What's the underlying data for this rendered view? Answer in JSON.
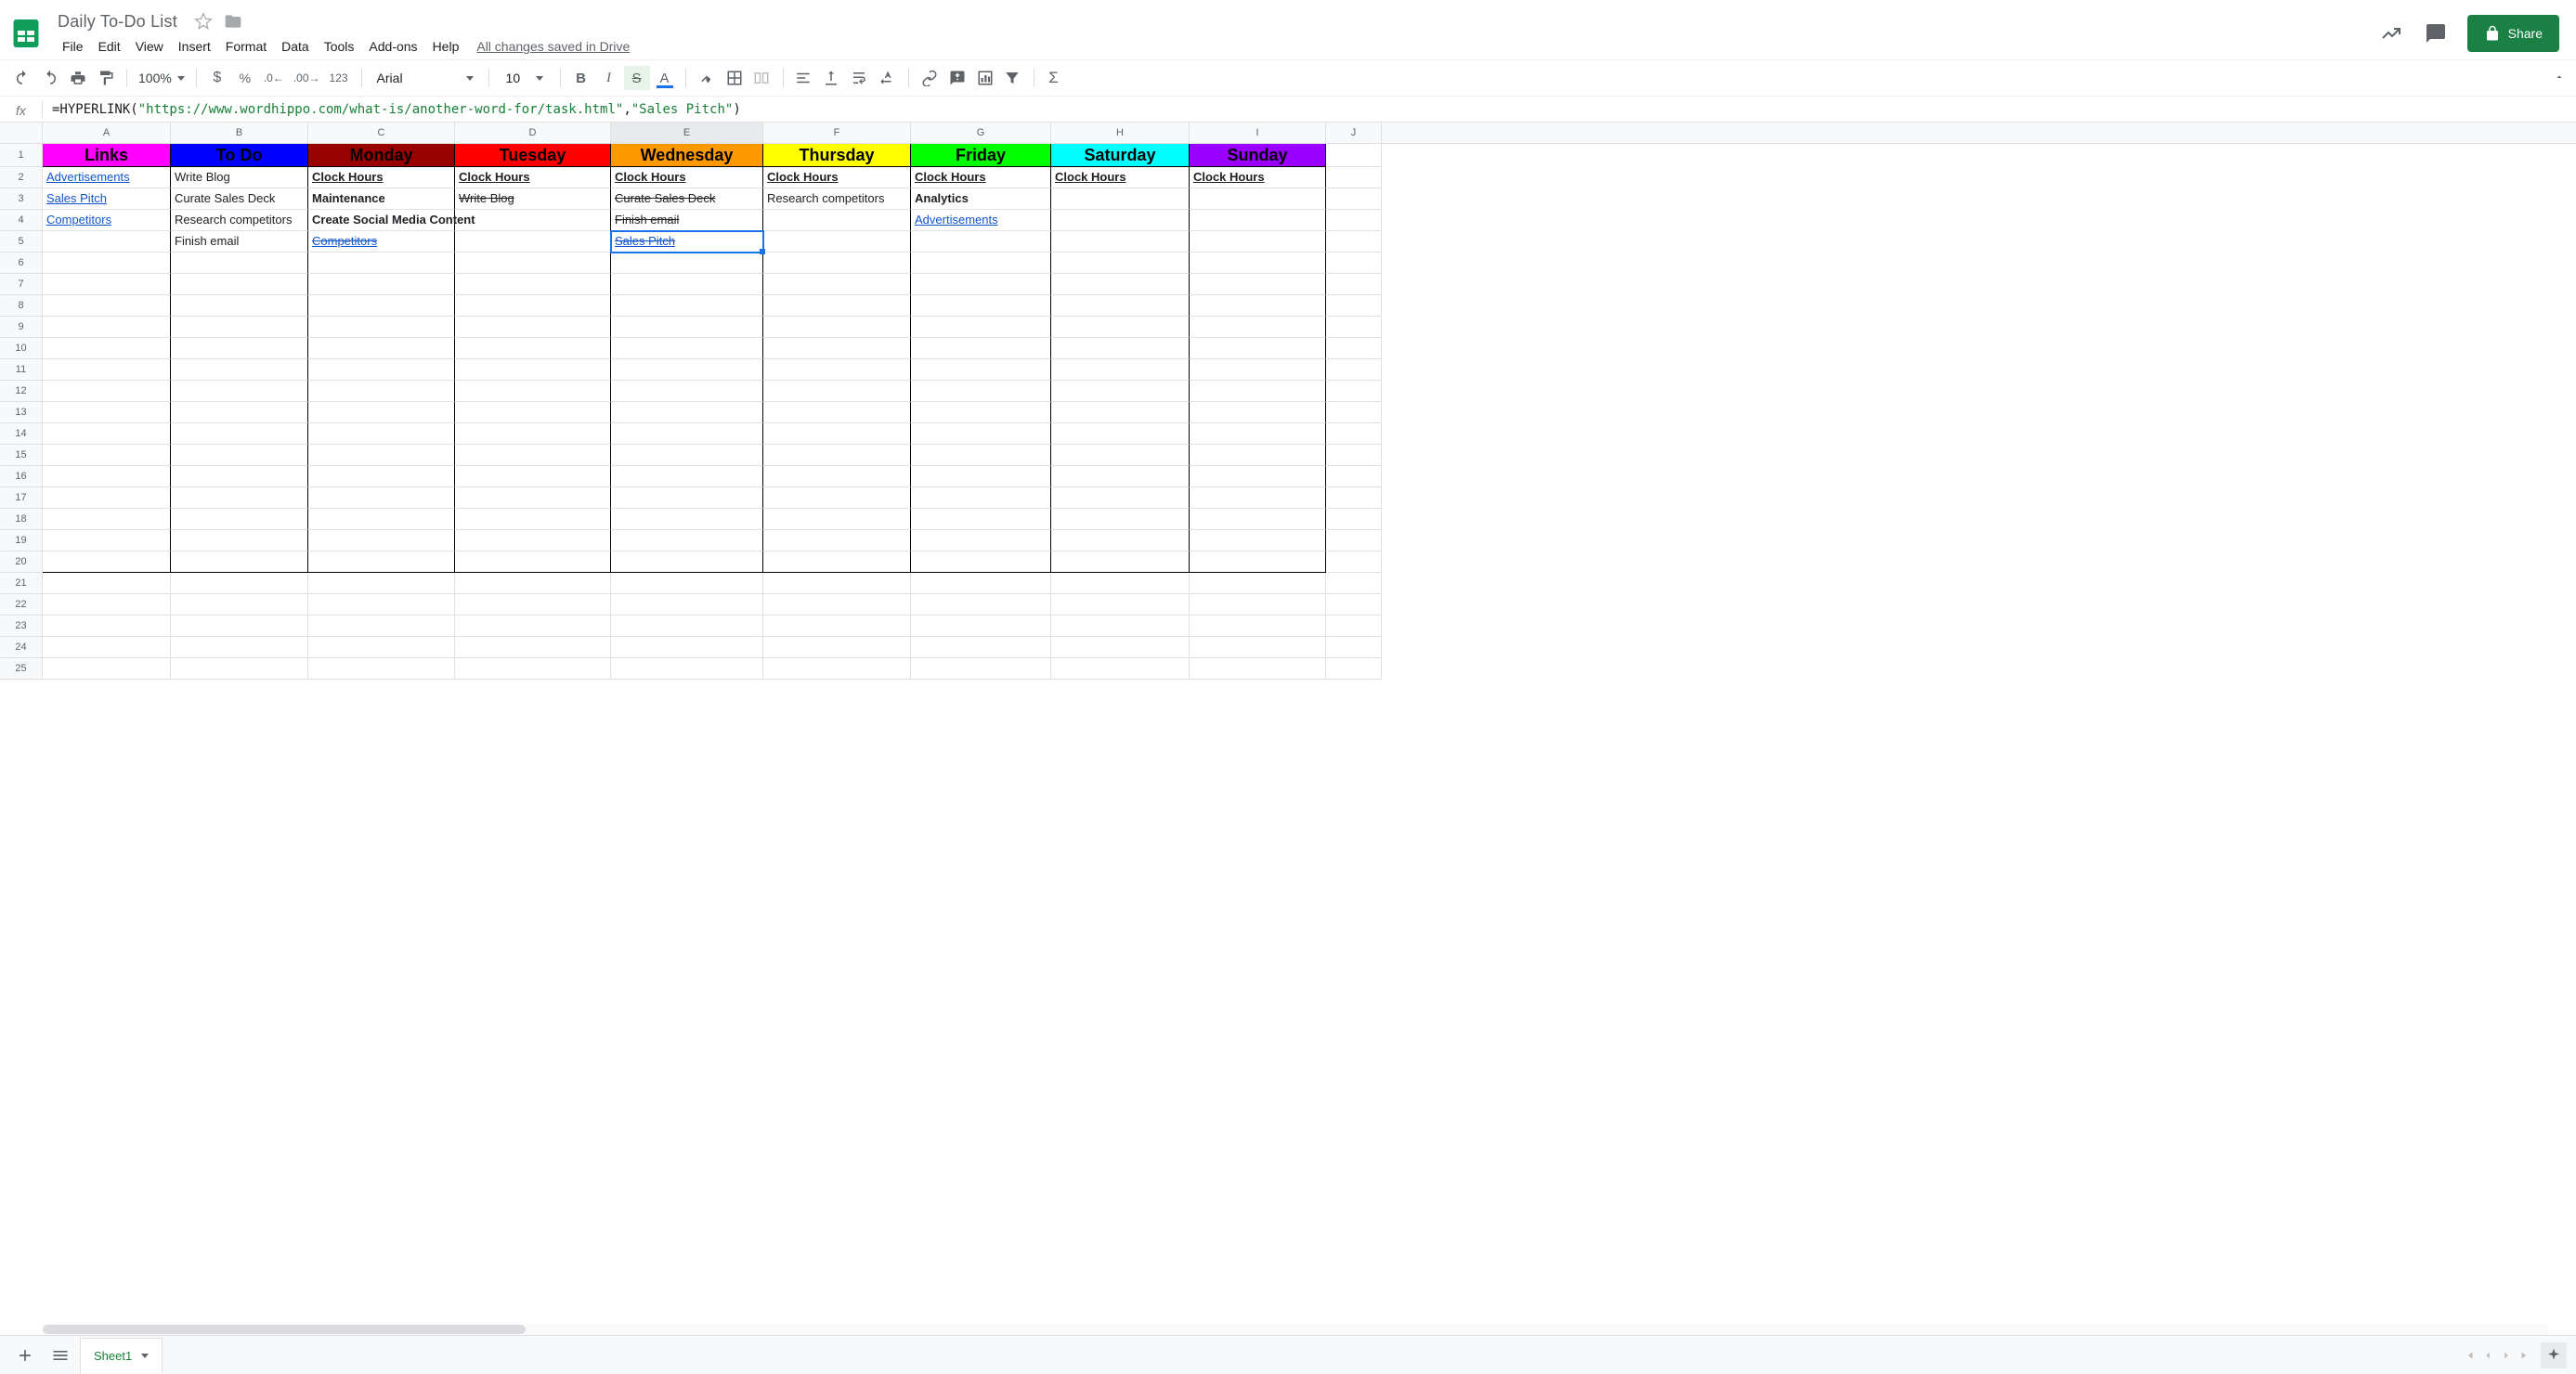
{
  "doc": {
    "title": "Daily To-Do List",
    "saved_msg": "All changes saved in Drive"
  },
  "menus": [
    "File",
    "Edit",
    "View",
    "Insert",
    "Format",
    "Data",
    "Tools",
    "Add-ons",
    "Help"
  ],
  "share_label": "Share",
  "toolbar": {
    "zoom": "100%",
    "font": "Arial",
    "size": "10",
    "more_fmt": "123"
  },
  "formula": {
    "prefix": "=HYPERLINK(",
    "url": "\"https://www.wordhippo.com/what-is/another-word-for/task.html\"",
    "sep": ",",
    "label": "\"Sales Pitch\"",
    "suffix": ")"
  },
  "sheet_tab": "Sheet1",
  "columns": [
    {
      "id": "A",
      "w": 138
    },
    {
      "id": "B",
      "w": 148
    },
    {
      "id": "C",
      "w": 158
    },
    {
      "id": "D",
      "w": 168
    },
    {
      "id": "E",
      "w": 164
    },
    {
      "id": "F",
      "w": 159
    },
    {
      "id": "G",
      "w": 151
    },
    {
      "id": "H",
      "w": 149
    },
    {
      "id": "I",
      "w": 147
    },
    {
      "id": "J",
      "w": 60
    }
  ],
  "selected_col": "E",
  "selected_cell": "E5",
  "header_row": [
    {
      "text": "Links",
      "bg": "#ff00ff",
      "fg": "#000"
    },
    {
      "text": "To Do",
      "bg": "#0000ff",
      "fg": "#000"
    },
    {
      "text": "Monday",
      "bg": "#990000",
      "fg": "#000"
    },
    {
      "text": "Tuesday",
      "bg": "#ff0000",
      "fg": "#000"
    },
    {
      "text": "Wednesday",
      "bg": "#ff9900",
      "fg": "#000"
    },
    {
      "text": "Thursday",
      "bg": "#ffff00",
      "fg": "#000"
    },
    {
      "text": "Friday",
      "bg": "#00ff00",
      "fg": "#000"
    },
    {
      "text": "Saturday",
      "bg": "#00ffff",
      "fg": "#000"
    },
    {
      "text": "Sunday",
      "bg": "#9900ff",
      "fg": "#000"
    }
  ],
  "body": [
    [
      {
        "t": "Advertisements",
        "cls": "link"
      },
      {
        "t": "Write Blog"
      },
      {
        "t": "Clock Hours",
        "cls": "bold underline"
      },
      {
        "t": "Clock Hours",
        "cls": "bold underline"
      },
      {
        "t": "Clock Hours",
        "cls": "bold underline"
      },
      {
        "t": "Clock Hours",
        "cls": "bold underline"
      },
      {
        "t": "Clock Hours",
        "cls": "bold underline"
      },
      {
        "t": "Clock Hours",
        "cls": "bold underline"
      },
      {
        "t": "Clock Hours",
        "cls": "bold underline"
      }
    ],
    [
      {
        "t": "Sales Pitch",
        "cls": "link"
      },
      {
        "t": "Curate Sales Deck"
      },
      {
        "t": "Maintenance",
        "cls": "bold"
      },
      {
        "t": "Write Blog",
        "cls": "strike"
      },
      {
        "t": "Curate Sales Deck",
        "cls": "strike"
      },
      {
        "t": "Research competitors"
      },
      {
        "t": "Analytics",
        "cls": "bold"
      },
      {
        "t": ""
      },
      {
        "t": ""
      }
    ],
    [
      {
        "t": "Competitors",
        "cls": "link"
      },
      {
        "t": "Research competitors"
      },
      {
        "t": "Create Social Media Content",
        "cls": "bold"
      },
      {
        "t": ""
      },
      {
        "t": "Finish email",
        "cls": "strike"
      },
      {
        "t": ""
      },
      {
        "t": "Advertisements",
        "cls": "link"
      },
      {
        "t": ""
      },
      {
        "t": ""
      }
    ],
    [
      {
        "t": ""
      },
      {
        "t": "Finish email"
      },
      {
        "t": "Competitors",
        "cls": "link strike"
      },
      {
        "t": ""
      },
      {
        "t": "Sales Pitch",
        "cls": "link strike"
      },
      {
        "t": ""
      },
      {
        "t": ""
      },
      {
        "t": ""
      },
      {
        "t": ""
      }
    ]
  ],
  "row_count_visible": 25
}
